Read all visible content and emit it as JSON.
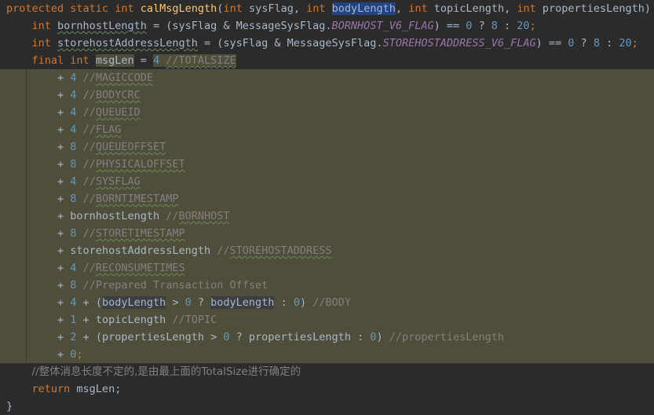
{
  "editor": {
    "theme": "darcula",
    "background": "#2b2b2b",
    "selection_background": "#4f4e3a",
    "text_selection_background": "#214283",
    "identifier_highlight_background": "#3c3f41",
    "foreground": "#a9b7c6",
    "keyword_color": "#cc7832",
    "number_color": "#6897bb",
    "comment_color": "#808080",
    "static_field_color": "#9876aa",
    "method_color": "#ffc66d",
    "typo_underline_color": "#6a8759",
    "font_size": "13.5px",
    "line_height": "22px",
    "language": "Java"
  },
  "code": {
    "line_01": {
      "t1": "protected",
      "t2": " ",
      "t3": "static",
      "t4": " ",
      "t5": "int",
      "t6": " ",
      "t7": "calMsgLength",
      "t8": "(",
      "t9": "int",
      "t10": " sysFlag, ",
      "t11": "int",
      "t12": " ",
      "t13": "bodyLength",
      "t14": ", ",
      "t15": "int",
      "t16": " topicLength, ",
      "t17": "int",
      "t18": " propertiesLength) {"
    },
    "line_02": {
      "t1": "int",
      "t2": " ",
      "t3": "bornhostLength",
      "t4": " = (sysFlag & MessageSysFlag.",
      "t5": "BORNHOST_V6_FLAG",
      "t6": ") == ",
      "t7": "0",
      "t8": " ? ",
      "t9": "8",
      "t10": " : ",
      "t11": "20",
      "t12": ";"
    },
    "line_03": {
      "t1": "int",
      "t2": " ",
      "t3": "storehostAddressLength",
      "t4": " = (sysFlag & MessageSysFlag.",
      "t5": "STOREHOSTADDRESS_V6_FLAG",
      "t6": ") == ",
      "t7": "0",
      "t8": " ? ",
      "t9": "8",
      "t10": " : ",
      "t11": "20",
      "t12": ";"
    },
    "line_04": {
      "t1": "final",
      "t2": " ",
      "t3": "int",
      "t4": " ",
      "t5": "msgLen",
      "t6": " = ",
      "t7": "4",
      "t8": " ",
      "t9": "//TOTALSIZE"
    },
    "line_05": {
      "op": "+ ",
      "num": "4",
      "sp": " ",
      "cmt_slash": "//",
      "cmt_word": "MAGICCODE"
    },
    "line_06": {
      "op": "+ ",
      "num": "4",
      "sp": " ",
      "cmt_slash": "//",
      "cmt_word": "BODYCRC"
    },
    "line_07": {
      "op": "+ ",
      "num": "4",
      "sp": " ",
      "cmt_slash": "//",
      "cmt_word": "QUEUEID"
    },
    "line_08": {
      "op": "+ ",
      "num": "4",
      "sp": " ",
      "cmt_slash": "//",
      "cmt_word": "FLAG"
    },
    "line_09": {
      "op": "+ ",
      "num": "8",
      "sp": " ",
      "cmt_slash": "//",
      "cmt_word": "QUEUEOFFSET"
    },
    "line_10": {
      "op": "+ ",
      "num": "8",
      "sp": " ",
      "cmt_slash": "//",
      "cmt_word": "PHYSICALOFFSET"
    },
    "line_11": {
      "op": "+ ",
      "num": "4",
      "sp": " ",
      "cmt_slash": "//",
      "cmt_word": "SYSFLAG"
    },
    "line_12": {
      "op": "+ ",
      "num": "8",
      "sp": " ",
      "cmt_slash": "//",
      "cmt_word": "BORNTIMESTAMP"
    },
    "line_13": {
      "op": "+ ",
      "ident": "bornhostLength",
      "sp": " ",
      "cmt_slash": "//",
      "cmt_word": "BORNHOST"
    },
    "line_14": {
      "op": "+ ",
      "num": "8",
      "sp": " ",
      "cmt_slash": "//",
      "cmt_word": "STORETIMESTAMP"
    },
    "line_15": {
      "op": "+ ",
      "ident": "storehostAddressLength",
      "sp": " ",
      "cmt_slash": "//",
      "cmt_word": "STOREHOSTADDRESS"
    },
    "line_16": {
      "op": "+ ",
      "num": "4",
      "sp": " ",
      "cmt_slash": "//",
      "cmt_word": "RECONSUMETIMES"
    },
    "line_17": {
      "op": "+ ",
      "num": "8",
      "sp": " ",
      "cmt_slash": "//",
      "cmt_plain": "//Prepared Transaction Offset"
    },
    "line_18": {
      "t1": "+ ",
      "t2": "4",
      "t3": " + (",
      "t4": "bodyLength",
      "t5": " > ",
      "t6": "0",
      "t7": " ? ",
      "t8": "bodyLength",
      "t9": " : ",
      "t10": "0",
      "t11": ") ",
      "t12": "//BODY"
    },
    "line_19": {
      "t1": "+ ",
      "t2": "1",
      "t3": " + topicLength ",
      "t4": "//TOPIC"
    },
    "line_20": {
      "t1": "+ ",
      "t2": "2",
      "t3": " + (propertiesLength > ",
      "t4": "0",
      "t5": " ? propertiesLength : ",
      "t6": "0",
      "t7": ") ",
      "t8": "//propertiesLength"
    },
    "line_21": {
      "t1": "+ ",
      "t2": "0",
      "t3": ";"
    },
    "line_22": {
      "comment": "//整体消息长度不定的,是由最上面的TotalSize进行确定的"
    },
    "line_23": {
      "t1": "return",
      "t2": " msgLen;"
    },
    "line_24": {
      "t1": "}"
    }
  }
}
